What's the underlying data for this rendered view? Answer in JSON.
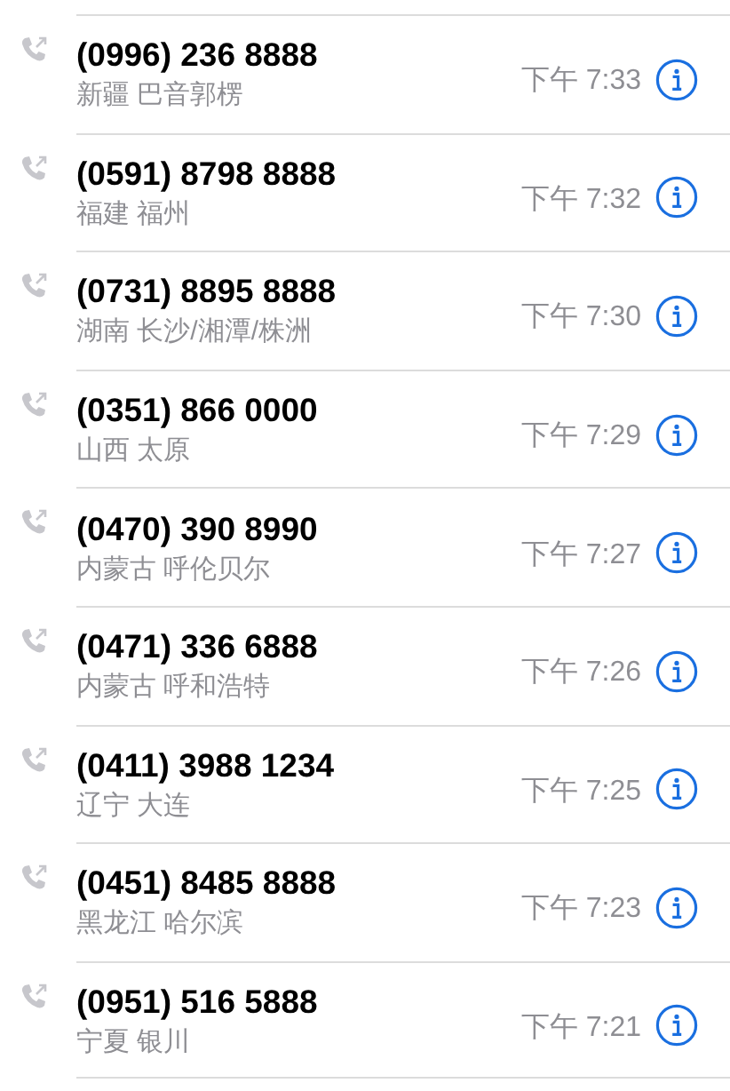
{
  "calls": [
    {
      "number": "(0996) 236 8888",
      "location": "新疆 巴音郭楞",
      "time": "下午 7:33"
    },
    {
      "number": "(0591) 8798 8888",
      "location": "福建 福州",
      "time": "下午 7:32"
    },
    {
      "number": "(0731) 8895 8888",
      "location": "湖南 长沙/湘潭/株洲",
      "time": "下午 7:30"
    },
    {
      "number": "(0351) 866 0000",
      "location": "山西 太原",
      "time": "下午 7:29"
    },
    {
      "number": "(0470) 390 8990",
      "location": "内蒙古 呼伦贝尔",
      "time": "下午 7:27"
    },
    {
      "number": "(0471) 336 6888",
      "location": "内蒙古 呼和浩特",
      "time": "下午 7:26"
    },
    {
      "number": "(0411) 3988 1234",
      "location": "辽宁 大连",
      "time": "下午 7:25"
    },
    {
      "number": "(0451) 8485 8888",
      "location": "黑龙江 哈尔滨",
      "time": "下午 7:23"
    },
    {
      "number": "(0951) 516 5888",
      "location": "宁夏 银川",
      "time": "下午 7:21"
    }
  ]
}
